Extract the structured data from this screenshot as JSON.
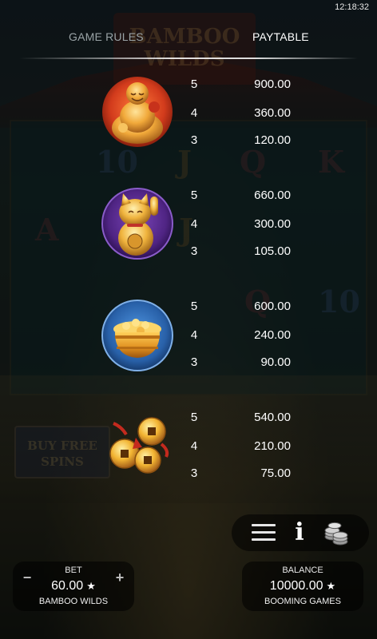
{
  "status_bar": {
    "time": "12:18:32"
  },
  "background": {
    "logo_text": [
      "BAMBOO",
      "WILDS"
    ],
    "buy_button_text": [
      "BUY FREE",
      "SPINS"
    ],
    "reel_glyphs": [
      "10",
      "J",
      "Q",
      "K",
      "A",
      "J",
      "Q",
      "10"
    ]
  },
  "tabs": {
    "game_rules": "GAME RULES",
    "paytable": "PAYTABLE",
    "active": "paytable"
  },
  "paytable": [
    {
      "symbol": "laughing-buddha",
      "icon": "buddha-icon",
      "payouts": [
        {
          "count": "5",
          "value": "900.00"
        },
        {
          "count": "4",
          "value": "360.00"
        },
        {
          "count": "3",
          "value": "120.00"
        }
      ]
    },
    {
      "symbol": "lucky-cat",
      "icon": "lucky-cat-icon",
      "payouts": [
        {
          "count": "5",
          "value": "660.00"
        },
        {
          "count": "4",
          "value": "300.00"
        },
        {
          "count": "3",
          "value": "105.00"
        }
      ]
    },
    {
      "symbol": "gold-pot",
      "icon": "gold-pot-icon",
      "payouts": [
        {
          "count": "5",
          "value": "600.00"
        },
        {
          "count": "4",
          "value": "240.00"
        },
        {
          "count": "3",
          "value": "90.00"
        }
      ]
    },
    {
      "symbol": "lucky-coins",
      "icon": "coins-icon",
      "payouts": [
        {
          "count": "5",
          "value": "540.00"
        },
        {
          "count": "4",
          "value": "210.00"
        },
        {
          "count": "3",
          "value": "75.00"
        }
      ]
    }
  ],
  "controls": {
    "menu_icon": "hamburger-icon",
    "info_icon": "info-icon",
    "chips_icon": "coin-stack-icon",
    "info_glyph": "i"
  },
  "bet": {
    "label": "BET",
    "value": "60.00",
    "star": "★",
    "game_name": "BAMBOO WILDS",
    "minus": "−",
    "plus": "+"
  },
  "balance": {
    "label": "BALANCE",
    "value": "10000.00",
    "star": "★",
    "provider": "BOOMING GAMES"
  },
  "colors": {
    "gold": "#e8a62a",
    "red": "#c4351f",
    "purple": "#5a2b8c",
    "blue": "#2c6fb5"
  }
}
